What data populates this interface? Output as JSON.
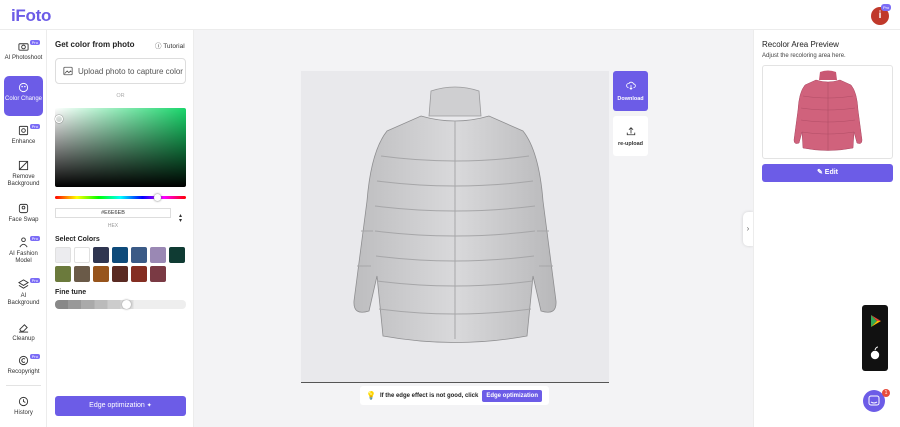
{
  "app": {
    "logo": "iFoto",
    "avatar_initial": "i",
    "avatar_badge": "Pro"
  },
  "sidebar": {
    "items": [
      {
        "label": "AI Photoshoot",
        "icon": "camera-icon",
        "pro": "Pro"
      },
      {
        "label": "Color Change",
        "icon": "palette-icon",
        "active": true
      },
      {
        "label": "Enhance",
        "icon": "enhance-icon",
        "pro": "Pro"
      },
      {
        "label": "Remove Background",
        "icon": "crop-icon"
      },
      {
        "label": "Face Swap",
        "icon": "face-icon"
      },
      {
        "label": "AI Fashion Model",
        "icon": "person-icon",
        "pro": "Pro"
      },
      {
        "label": "AI Background",
        "icon": "layers-icon",
        "pro": "Pro"
      },
      {
        "label": "Cleanup",
        "icon": "eraser-icon"
      },
      {
        "label": "Recopyright",
        "icon": "copyright-icon",
        "pro": "Pro"
      },
      {
        "label": "History",
        "icon": "history-icon"
      }
    ]
  },
  "panel": {
    "title": "Get color from photo",
    "tutorial": "Tutorial",
    "upload_label": "Upload photo to capture color",
    "or_label": "OR",
    "hex_value": "#E6E6EB",
    "hex_label": "HEX",
    "select_colors_label": "Select Colors",
    "swatches": [
      "#ececef",
      "#ffffff",
      "#2f3550",
      "#0e4a7a",
      "#3b5a86",
      "#9a88b4",
      "#0f3b33",
      "#6b7a3c",
      "#6a5a48",
      "#97541c",
      "#5a2a22",
      "#842e22",
      "#7a3a44"
    ],
    "fine_tune_label": "Fine tune",
    "fine_tune_level": 0.55,
    "edge_button": "Edge optimization",
    "accent": "#6c5ce7"
  },
  "canvas": {
    "download_label": "Download",
    "reupload_label": "re-upload",
    "tip_text": "If the edge effect is not good, click",
    "tip_button": "Edge optimization"
  },
  "right_panel": {
    "title": "Recolor Area Preview",
    "subtitle": "Adjust the recoloring area here.",
    "edit_label": "Edit",
    "preview_color": "#d0627c"
  },
  "floating": {
    "chat_badge": "1"
  }
}
